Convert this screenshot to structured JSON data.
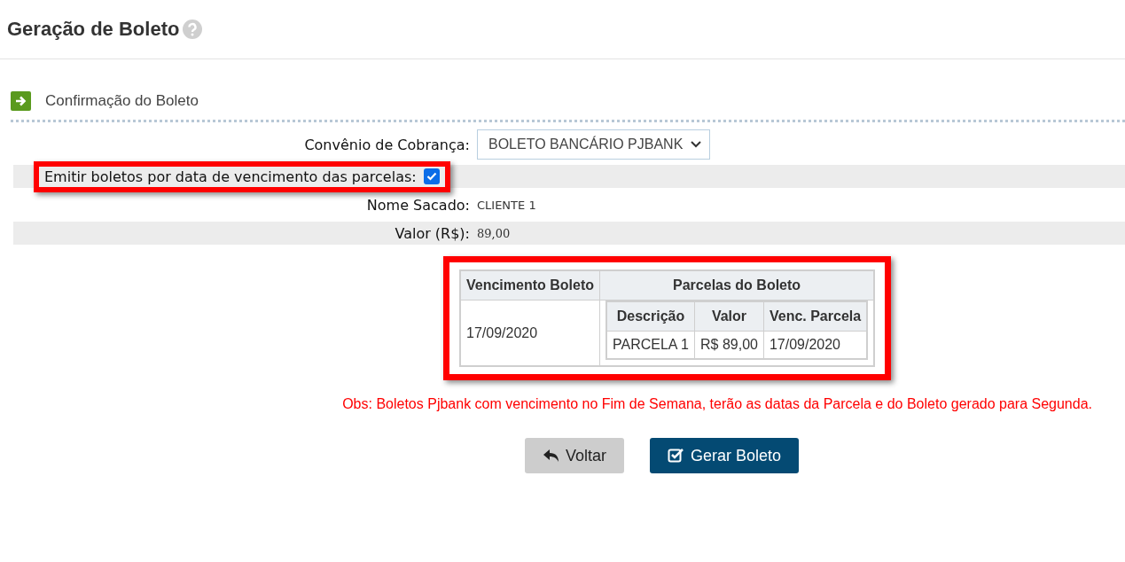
{
  "page": {
    "title": "Geração de Boleto"
  },
  "section": {
    "title": "Confirmação do Boleto"
  },
  "fields": [
    {
      "kind": "select",
      "label": "Convênio de Cobrança:",
      "value": "BOLETO BANCÁRIO PJBANK"
    },
    {
      "kind": "checkbox",
      "label": "Emitir boletos por data de vencimento das parcelas:",
      "checked": true,
      "highlighted": true
    },
    {
      "kind": "text",
      "label": "Nome Sacado:",
      "value": "CLIENTE 1"
    },
    {
      "kind": "amount",
      "label": "Valor (R$):",
      "value": "89,00"
    }
  ],
  "boleto_table": {
    "highlighted": true,
    "columns": [
      "Vencimento Boleto",
      "Parcelas do Boleto"
    ],
    "due_date": "17/09/2020",
    "parcelas": {
      "columns": [
        "Descrição",
        "Valor",
        "Venc. Parcela"
      ],
      "rows": [
        [
          "PARCELA 1",
          "R$ 89,00",
          "17/09/2020"
        ]
      ]
    }
  },
  "note": "Obs: Boletos Pjbank com vencimento no Fim de Semana, terão as datas da Parcela e do Boleto gerado para Segunda.",
  "buttons": [
    {
      "kind": "back",
      "label": "Voltar"
    },
    {
      "kind": "primary",
      "label": "Gerar Boleto"
    }
  ]
}
